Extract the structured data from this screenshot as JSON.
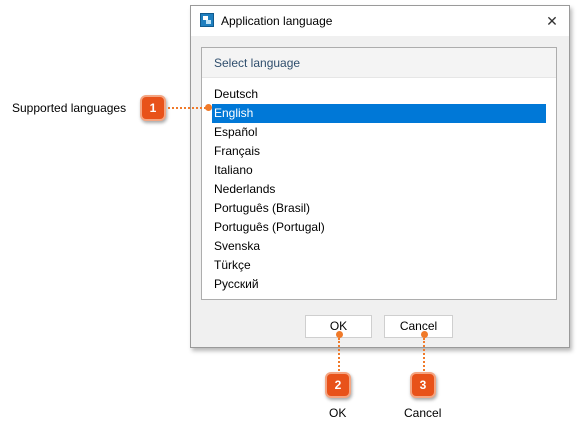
{
  "dialog": {
    "title": "Application language",
    "close_icon": "close-icon",
    "app_icon": "app-language-icon",
    "panel_header": "Select language",
    "languages": [
      {
        "label": "Deutsch",
        "selected": false
      },
      {
        "label": "English",
        "selected": true
      },
      {
        "label": "Español",
        "selected": false
      },
      {
        "label": "Français",
        "selected": false
      },
      {
        "label": "Italiano",
        "selected": false
      },
      {
        "label": "Nederlands",
        "selected": false
      },
      {
        "label": "Português (Brasil)",
        "selected": false
      },
      {
        "label": "Português (Portugal)",
        "selected": false
      },
      {
        "label": "Svenska",
        "selected": false
      },
      {
        "label": "Türkçe",
        "selected": false
      },
      {
        "label": "Русский",
        "selected": false
      }
    ],
    "ok_label": "OK",
    "cancel_label": "Cancel"
  },
  "callouts": [
    {
      "number": "1",
      "label": "Supported languages"
    },
    {
      "number": "2",
      "label": "OK"
    },
    {
      "number": "3",
      "label": "Cancel"
    }
  ],
  "colors": {
    "selection": "#0078d7",
    "callout_badge": "#e8521a",
    "callout_leader": "#f07a2a"
  }
}
